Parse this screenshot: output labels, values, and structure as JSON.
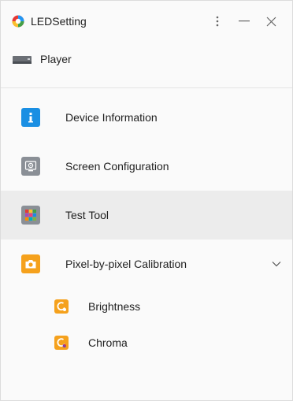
{
  "app": {
    "title": "LEDSetting",
    "icon": "ledsetting-logo-icon"
  },
  "window_controls": {
    "more_icon": "more-vertical-icon",
    "minimize_icon": "minimize-icon",
    "close_icon": "close-icon"
  },
  "player": {
    "label": "Player",
    "icon": "player-device-icon"
  },
  "nav": {
    "items": [
      {
        "label": "Device Information",
        "icon": "info-icon",
        "color": "#1a8fe3"
      },
      {
        "label": "Screen Configuration",
        "icon": "screen-config-icon",
        "color": "#8a8f96"
      },
      {
        "label": "Test Tool",
        "icon": "test-tool-icon",
        "color": "#8a8f96",
        "active": true
      },
      {
        "label": "Pixel-by-pixel Calibration",
        "icon": "calibration-camera-icon",
        "color": "#f5a11c",
        "expanded": true
      }
    ],
    "sub_items": [
      {
        "label": "Brightness",
        "icon": "brightness-calibration-icon",
        "color": "#f5a11c"
      },
      {
        "label": "Chroma",
        "icon": "chroma-calibration-icon",
        "color": "#f5a11c"
      }
    ]
  },
  "colors": {
    "active_bg": "#ececec",
    "accent_blue": "#1a8fe3",
    "accent_orange": "#f5a11c",
    "accent_gray": "#8a8f96"
  }
}
